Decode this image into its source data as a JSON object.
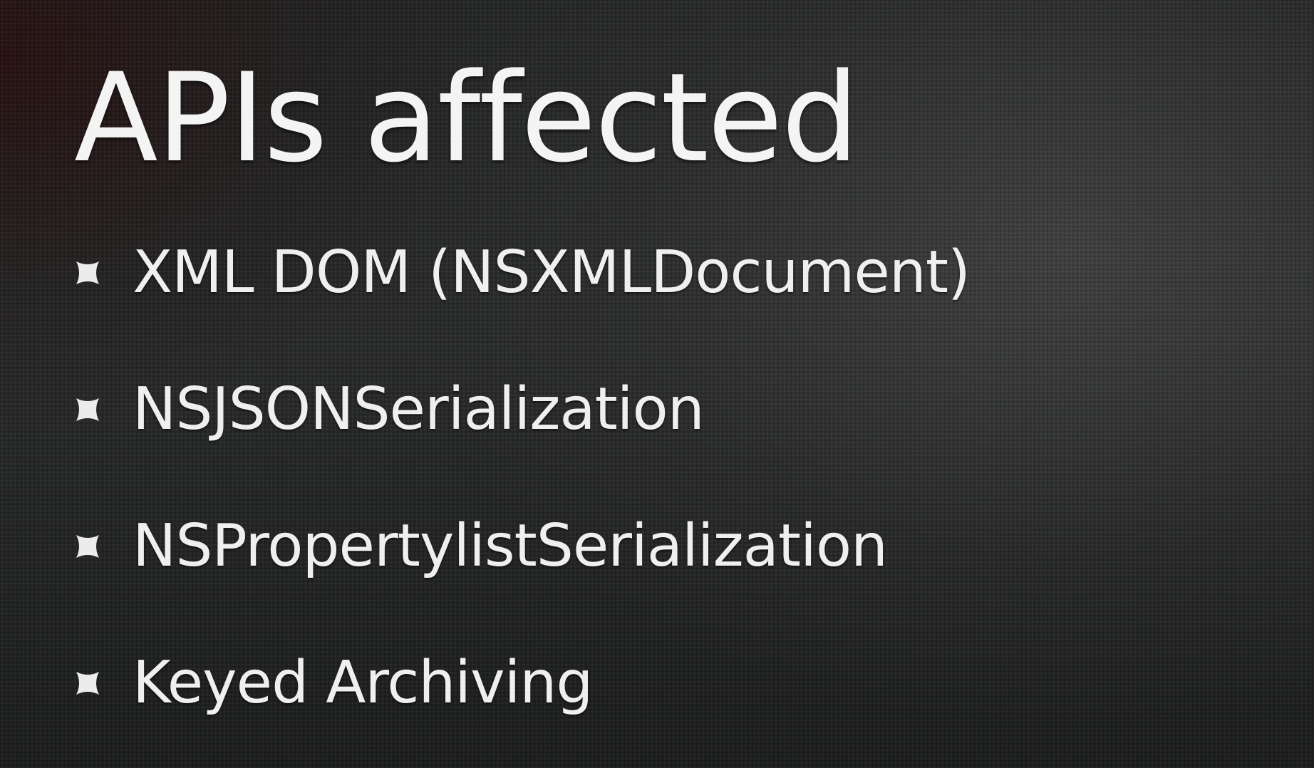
{
  "slide": {
    "title": "APIs affected",
    "bullet_icon": "bullet-icon",
    "bullets": [
      {
        "label": "XML DOM (NSXMLDocument)"
      },
      {
        "label": "NSJSONSerialization"
      },
      {
        "label": "NSPropertylistSerialization"
      },
      {
        "label": "Keyed Archiving"
      }
    ]
  },
  "colors": {
    "background": "#262727",
    "text": "#efefef"
  }
}
